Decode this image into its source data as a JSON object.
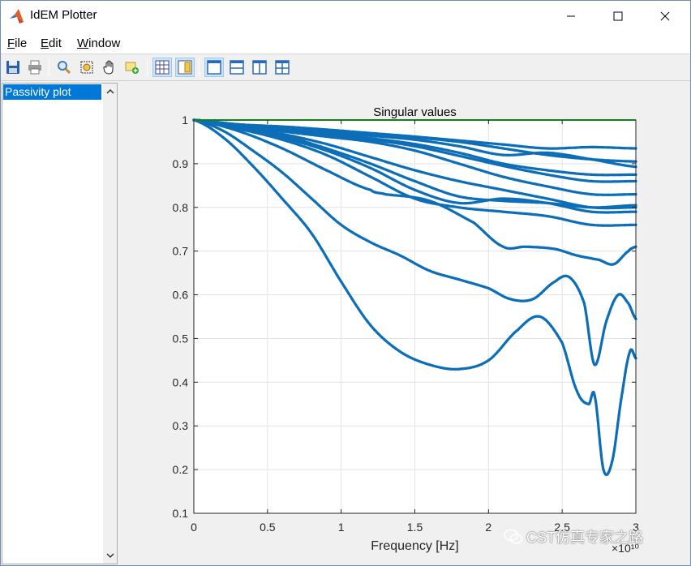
{
  "window": {
    "title": "IdEM Plotter"
  },
  "menu": [
    {
      "label": "File",
      "ul": "F",
      "rest": "ile"
    },
    {
      "label": "Edit",
      "ul": "E",
      "rest": "dit"
    },
    {
      "label": "Window",
      "ul": "W",
      "rest": "indow"
    }
  ],
  "toolbar": {
    "icons": [
      "save-icon",
      "print-icon",
      "zoom-icon",
      "zoom-box-icon",
      "pan-hand-icon",
      "data-cursor-icon",
      "grid-icon",
      "legend-icon",
      "layout-single-icon",
      "layout-split-h-icon",
      "layout-split-v-icon",
      "layout-quad-icon"
    ]
  },
  "sidebar": {
    "items": [
      {
        "label": "Passivity plot",
        "selected": true
      }
    ]
  },
  "watermark": {
    "text": "CST仿真专家之路"
  },
  "colors": {
    "series": "#0d6eb8",
    "threshold": "#00e000",
    "selection": "#0078d7"
  },
  "chart_data": {
    "type": "line",
    "title": "Singular values",
    "xlabel": "Frequency [Hz]",
    "ylabel": "",
    "x_exponent_label": "×10¹⁰",
    "xlim": [
      0,
      3
    ],
    "ylim": [
      0.1,
      1
    ],
    "xticks": [
      "0",
      "0.5",
      "1",
      "1.5",
      "2",
      "2.5",
      "3"
    ],
    "yticks": [
      "0.1",
      "0.2",
      "0.3",
      "0.4",
      "0.5",
      "0.6",
      "0.7",
      "0.8",
      "0.9",
      "1"
    ],
    "grid": true,
    "threshold": {
      "y": 1,
      "color": "#00e000"
    },
    "series": [
      {
        "x": [
          0,
          0.3,
          0.6,
          0.9,
          1.2,
          1.5,
          1.8,
          2.1,
          2.4,
          2.7,
          3.0
        ],
        "y": [
          1,
          0.99,
          0.985,
          0.978,
          0.97,
          0.962,
          0.953,
          0.944,
          0.935,
          0.938,
          0.935
        ]
      },
      {
        "x": [
          0,
          0.3,
          0.6,
          0.9,
          1.2,
          1.5,
          1.8,
          2.1,
          2.4,
          2.7,
          3.0
        ],
        "y": [
          1,
          0.99,
          0.983,
          0.975,
          0.967,
          0.96,
          0.95,
          0.935,
          0.92,
          0.91,
          0.905
        ]
      },
      {
        "x": [
          0,
          0.3,
          0.6,
          0.9,
          1.2,
          1.5,
          1.8,
          2.1,
          2.4,
          2.7,
          3.0
        ],
        "y": [
          1,
          0.989,
          0.98,
          0.972,
          0.964,
          0.955,
          0.94,
          0.92,
          0.925,
          0.91,
          0.893
        ]
      },
      {
        "x": [
          0,
          0.3,
          0.6,
          0.9,
          1.2,
          1.5,
          1.8,
          2.1,
          2.4,
          2.7,
          3.0
        ],
        "y": [
          1,
          0.988,
          0.978,
          0.968,
          0.958,
          0.945,
          0.925,
          0.9,
          0.885,
          0.875,
          0.875
        ]
      },
      {
        "x": [
          0,
          0.3,
          0.6,
          0.9,
          1.2,
          1.5,
          1.8,
          2.1,
          2.4,
          2.7,
          3.0
        ],
        "y": [
          1,
          0.988,
          0.976,
          0.965,
          0.955,
          0.94,
          0.918,
          0.895,
          0.875,
          0.86,
          0.86
        ]
      },
      {
        "x": [
          0,
          0.3,
          0.6,
          0.9,
          1.2,
          1.5,
          1.8,
          2.1,
          2.4,
          2.7,
          3.0
        ],
        "y": [
          1,
          0.987,
          0.974,
          0.962,
          0.95,
          0.93,
          0.9,
          0.87,
          0.848,
          0.83,
          0.83
        ]
      },
      {
        "x": [
          0,
          0.3,
          0.6,
          0.9,
          1.2,
          1.5,
          1.8,
          2.1,
          2.4,
          2.7,
          3.0
        ],
        "y": [
          1,
          0.985,
          0.968,
          0.945,
          0.915,
          0.885,
          0.86,
          0.84,
          0.82,
          0.8,
          0.8
        ]
      },
      {
        "x": [
          0,
          0.3,
          0.6,
          0.9,
          1.2,
          1.5,
          1.8,
          2.1,
          2.4,
          2.7,
          3.0
        ],
        "y": [
          1,
          0.985,
          0.965,
          0.935,
          0.9,
          0.86,
          0.825,
          0.815,
          0.81,
          0.8,
          0.805
        ]
      },
      {
        "x": [
          0,
          0.3,
          0.6,
          0.9,
          1.2,
          1.5,
          1.8,
          2.1,
          2.4,
          2.7,
          3.0
        ],
        "y": [
          1,
          0.983,
          0.96,
          0.93,
          0.89,
          0.84,
          0.81,
          0.82,
          0.81,
          0.79,
          0.79
        ]
      },
      {
        "x": [
          0,
          0.3,
          0.6,
          0.9,
          1.2,
          1.5,
          1.8,
          2.1,
          2.4,
          2.7,
          3.0
        ],
        "y": [
          1,
          0.98,
          0.955,
          0.92,
          0.87,
          0.82,
          0.8,
          0.79,
          0.78,
          0.76,
          0.76
        ]
      },
      {
        "x": [
          0,
          0.3,
          0.6,
          0.9,
          1.2,
          1.3,
          1.6,
          1.9,
          2.1,
          2.25,
          2.45,
          2.6,
          2.75,
          2.85,
          2.95,
          3.0
        ],
        "y": [
          1,
          0.975,
          0.935,
          0.885,
          0.84,
          0.83,
          0.815,
          0.765,
          0.71,
          0.71,
          0.705,
          0.69,
          0.68,
          0.67,
          0.7,
          0.71
        ]
      },
      {
        "x": [
          0,
          0.2,
          0.4,
          0.6,
          0.8,
          1.0,
          1.2,
          1.4,
          1.6,
          1.8,
          2.0,
          2.15,
          2.3,
          2.45,
          2.55,
          2.65,
          2.72,
          2.8,
          2.88,
          2.95,
          3.0
        ],
        "y": [
          1,
          0.975,
          0.93,
          0.88,
          0.82,
          0.76,
          0.72,
          0.69,
          0.655,
          0.635,
          0.615,
          0.59,
          0.59,
          0.63,
          0.64,
          0.58,
          0.44,
          0.54,
          0.6,
          0.58,
          0.545
        ]
      },
      {
        "x": [
          0,
          0.2,
          0.4,
          0.6,
          0.8,
          1.0,
          1.2,
          1.4,
          1.6,
          1.8,
          2.0,
          2.2,
          2.35,
          2.5,
          2.6,
          2.68,
          2.72,
          2.78,
          2.84,
          2.9,
          2.96,
          3.0
        ],
        "y": [
          1,
          0.96,
          0.895,
          0.82,
          0.74,
          0.63,
          0.53,
          0.47,
          0.44,
          0.43,
          0.45,
          0.52,
          0.55,
          0.49,
          0.38,
          0.35,
          0.37,
          0.2,
          0.22,
          0.36,
          0.47,
          0.455
        ]
      }
    ]
  }
}
